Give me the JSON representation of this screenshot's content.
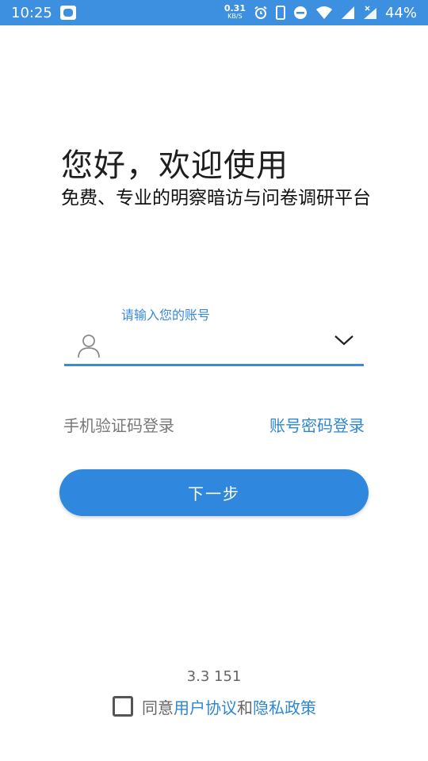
{
  "status_bar": {
    "time": "10:25",
    "net_speed_value": "0.31",
    "net_speed_unit": "KB/S",
    "battery": "44%",
    "icons": [
      "app-notification-icon",
      "alarm-icon",
      "phone-icon",
      "do-not-disturb-icon",
      "wifi-icon",
      "signal-icon",
      "signal-x-icon"
    ]
  },
  "header": {
    "greeting": "您好，欢迎使用",
    "subtitle": "免费、专业的明察暗访与问卷调研平台"
  },
  "account": {
    "label": "请输入您的账号",
    "value": ""
  },
  "login_options": {
    "sms_login": "手机验证码登录",
    "password_login": "账号密码登录"
  },
  "next_button": {
    "label": "下一步"
  },
  "footer": {
    "version": "3.3 151",
    "agree_prefix": "同意",
    "user_agreement": "用户协议",
    "and": "和",
    "privacy_policy": "隐私政策",
    "agreed": false
  },
  "colors": {
    "status_bar": "#3d8fe0",
    "accent": "#2f88de",
    "link": "#2f86d2"
  }
}
